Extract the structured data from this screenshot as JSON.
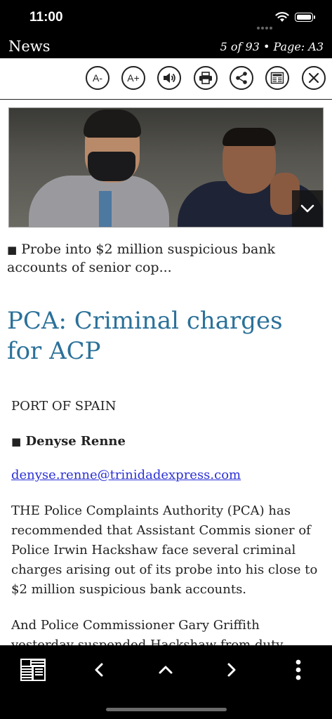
{
  "status_bar": {
    "time": "11:00"
  },
  "header": {
    "title": "News",
    "page_info": "5 of 93 • Page: A3"
  },
  "toolbar": {
    "font_decrease_label": "A-",
    "font_increase_label": "A+",
    "icons": [
      "font-decrease-icon",
      "font-increase-icon",
      "speaker-icon",
      "print-icon",
      "share-icon",
      "newspaper-icon",
      "close-icon"
    ]
  },
  "article": {
    "caption_bullet": "■",
    "caption": "Probe into $2 million suspicious bank accounts of senior cop...",
    "headline": "PCA: Criminal charges for ACP",
    "dateline": "PORT OF SPAIN",
    "byline_bullet": "■",
    "byline": "Denyse Renne",
    "email": "denyse.renne@trinidadexpress.com",
    "paragraphs": [
      "THE Police Complaints Authority (PCA) has recommended that Assistant Commis sioner of Police Irwin Hackshaw face several criminal charges arising out of its probe into his close to $2 million suspicious bank accounts.",
      "And Police Commissioner Gary Griffith yesterday suspended Hackshaw from duty"
    ]
  },
  "bottom_bar": {
    "icons": [
      "newspaper-icon",
      "chevron-left-icon",
      "chevron-up-icon",
      "chevron-right-icon",
      "more-vertical-icon"
    ]
  },
  "colors": {
    "headline": "#2b7199",
    "link": "#2a2fd6",
    "bars": "#000000"
  }
}
